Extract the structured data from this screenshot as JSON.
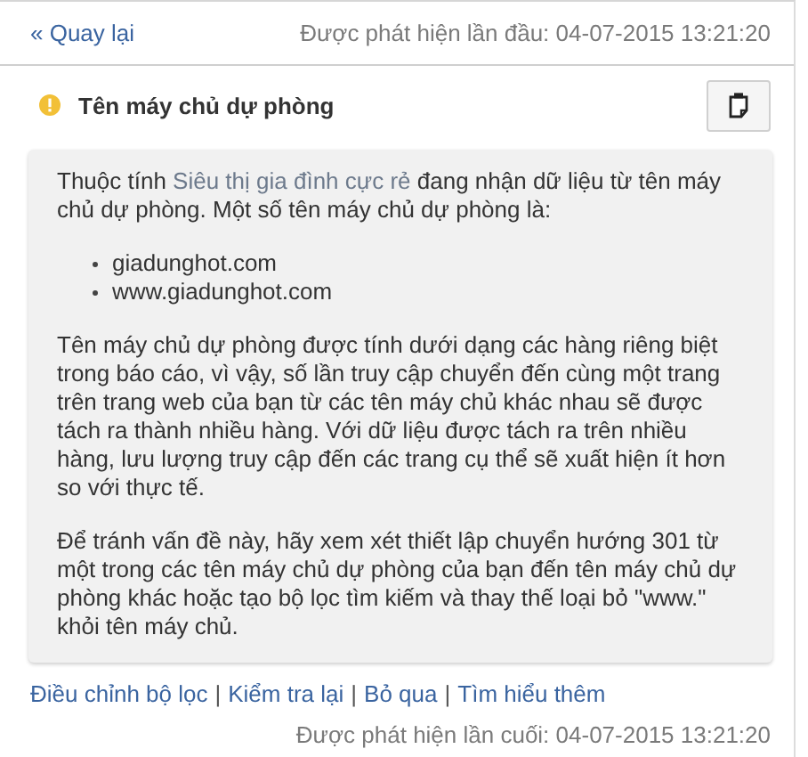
{
  "header": {
    "back_link": "« Quay lại",
    "first_detected": "Được phát hiện lần đầu: 04-07-2015 13:21:20"
  },
  "issue": {
    "title": "Tên máy chủ dự phòng"
  },
  "intro": {
    "before": "Thuộc tính ",
    "link": "Siêu thị gia đình cực rẻ",
    "after": " đang nhận dữ liệu từ tên máy chủ dự phòng. Một số tên máy chủ dự phòng là:"
  },
  "hostnames": [
    "giadunghot.com",
    "www.giadunghot.com"
  ],
  "paragraphs": [
    "Tên máy chủ dự phòng được tính dưới dạng các hàng riêng biệt trong báo cáo, vì vậy, số lần truy cập chuyển đến cùng một trang trên trang web của bạn từ các tên máy chủ khác nhau sẽ được tách ra thành nhiều hàng. Với dữ liệu được tách ra trên nhiều hàng, lưu lượng truy cập đến các trang cụ thể sẽ xuất hiện ít hơn so với thực tế.",
    "Để tránh vấn đề này, hãy xem xét thiết lập chuyển hướng 301 từ một trong các tên máy chủ dự phòng của bạn đến tên máy chủ dự phòng khác hoặc tạo bộ lọc tìm kiếm và thay thế loại bỏ \"www.\" khỏi tên máy chủ."
  ],
  "actions": [
    "Điều chỉnh bộ lọc",
    "Kiểm tra lại",
    "Bỏ qua",
    "Tìm hiểu thêm"
  ],
  "separators": [
    "|",
    "|",
    "|"
  ],
  "last_detected": "Được phát hiện lần cuối: 04-07-2015 13:21:20"
}
